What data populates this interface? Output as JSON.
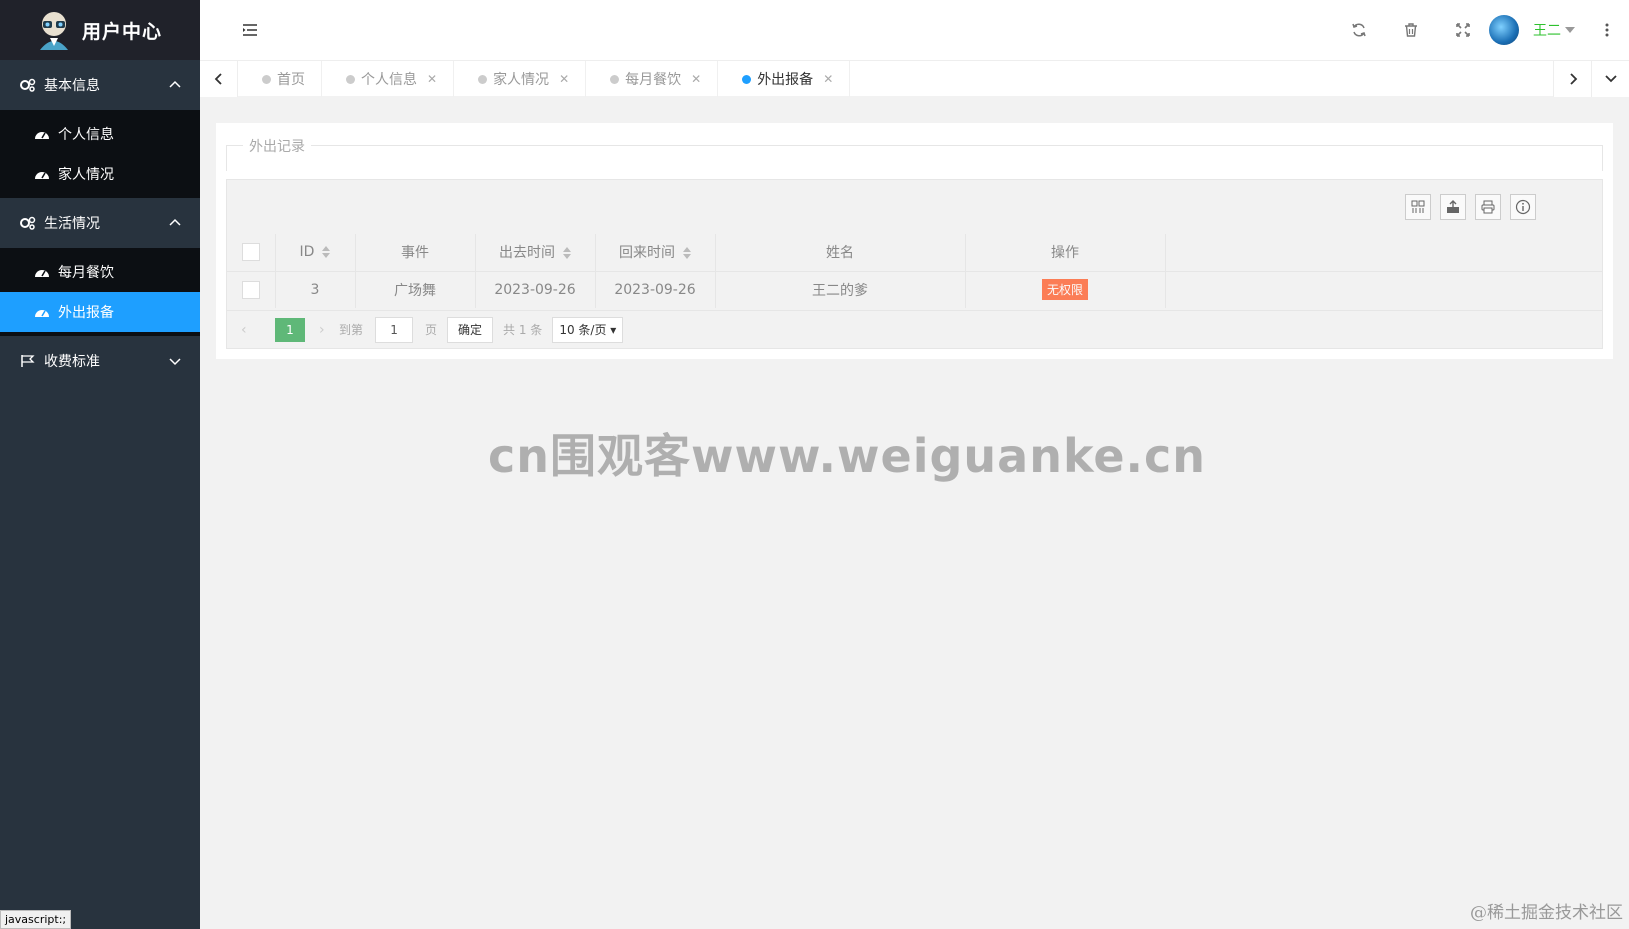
{
  "app": {
    "title": "用户中心"
  },
  "sidebar": {
    "groups": [
      {
        "label": "基本信息",
        "items": [
          "个人信息",
          "家人情况"
        ],
        "expanded": true
      },
      {
        "label": "生活情况",
        "items": [
          "每月餐饮",
          "外出报备"
        ],
        "expanded": true
      },
      {
        "label": "收费标准",
        "items": [],
        "expanded": false
      }
    ],
    "active_item": "外出报备"
  },
  "status_tip": "javascript:;",
  "header": {
    "user_name": "王二",
    "icons": [
      "refresh-icon",
      "trash-icon",
      "fullscreen-icon",
      "avatar",
      "more-icon"
    ]
  },
  "tabs": [
    {
      "label": "首页",
      "closable": false,
      "active": false
    },
    {
      "label": "个人信息",
      "closable": true,
      "active": false
    },
    {
      "label": "家人情况",
      "closable": true,
      "active": false
    },
    {
      "label": "每月餐饮",
      "closable": true,
      "active": false
    },
    {
      "label": "外出报备",
      "closable": true,
      "active": true
    }
  ],
  "panel": {
    "legend": "外出记录",
    "table": {
      "columns": [
        "ID",
        "事件",
        "出去时间",
        "回来时间",
        "姓名",
        "操作"
      ],
      "rows": [
        {
          "id": "3",
          "event": "广场舞",
          "out_time": "2023-09-26",
          "back_time": "2023-09-26",
          "name": "王二的爹",
          "action": "无权限"
        }
      ]
    },
    "pager": {
      "current": "1",
      "goto_label": "到第",
      "goto_value": "1",
      "page_unit": "页",
      "confirm": "确定",
      "total": "共 1 条",
      "page_size": "10 条/页"
    }
  },
  "watermark": "cn围观客www.weiguanke.cn",
  "watermark2": "@稀土掘金技术社区",
  "colors": {
    "sidebar_bg": "#28333e",
    "active": "#1e9fff",
    "user_name": "#2ec12e",
    "badge": "#ff5722"
  }
}
